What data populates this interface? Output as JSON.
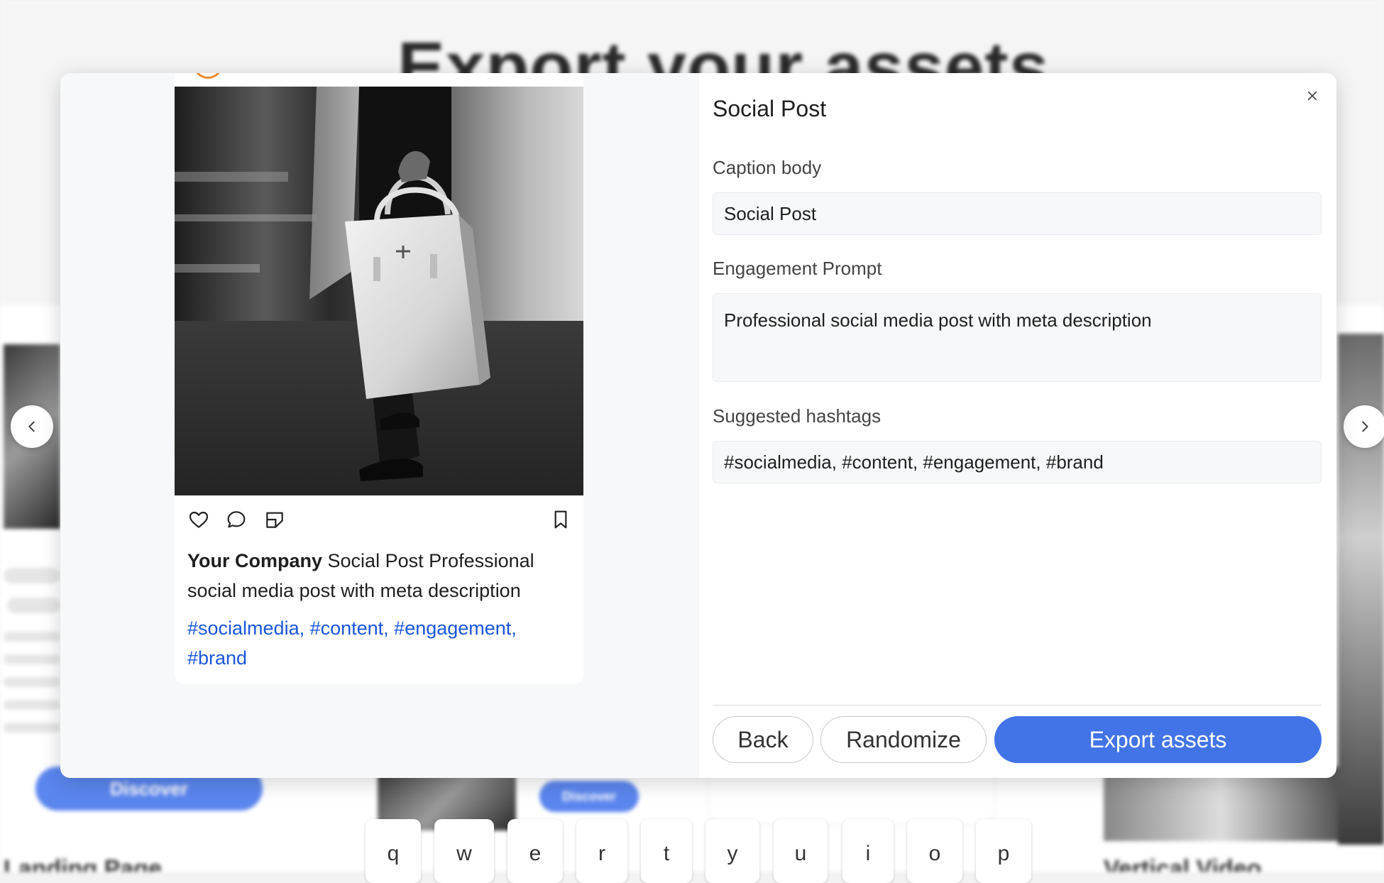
{
  "background": {
    "heading": "Export your assets",
    "discover_label": "Discover",
    "landing_label": "Landing Page",
    "vertical_label": "Vertical Video"
  },
  "modal": {
    "preview": {
      "company": "Your Company",
      "caption": "Social Post Professional social media post with meta description",
      "hashtags": "#socialmedia, #content, #engagement, #brand",
      "icons": [
        "heart-icon",
        "comment-icon",
        "share-icon",
        "bookmark-icon"
      ]
    },
    "form": {
      "title": "Social Post",
      "caption_label": "Caption body",
      "caption_value": "Social Post",
      "prompt_label": "Engagement Prompt",
      "prompt_value": "Professional social media post with meta description",
      "hashtags_label": "Suggested hashtags",
      "hashtags_value": "#socialmedia, #content, #engagement, #brand"
    },
    "buttons": {
      "back": "Back",
      "randomize": "Randomize",
      "export": "Export assets"
    }
  },
  "navigation": {
    "prev_icon": "chevron-left-icon",
    "next_icon": "chevron-right-icon"
  },
  "keyboard": {
    "keys": [
      "q",
      "w",
      "e",
      "r",
      "t",
      "y",
      "u",
      "i",
      "o",
      "p"
    ]
  },
  "colors": {
    "accent": "#4274e8",
    "hashtag": "#1a56db",
    "avatar_ring": "#f08a2b"
  }
}
